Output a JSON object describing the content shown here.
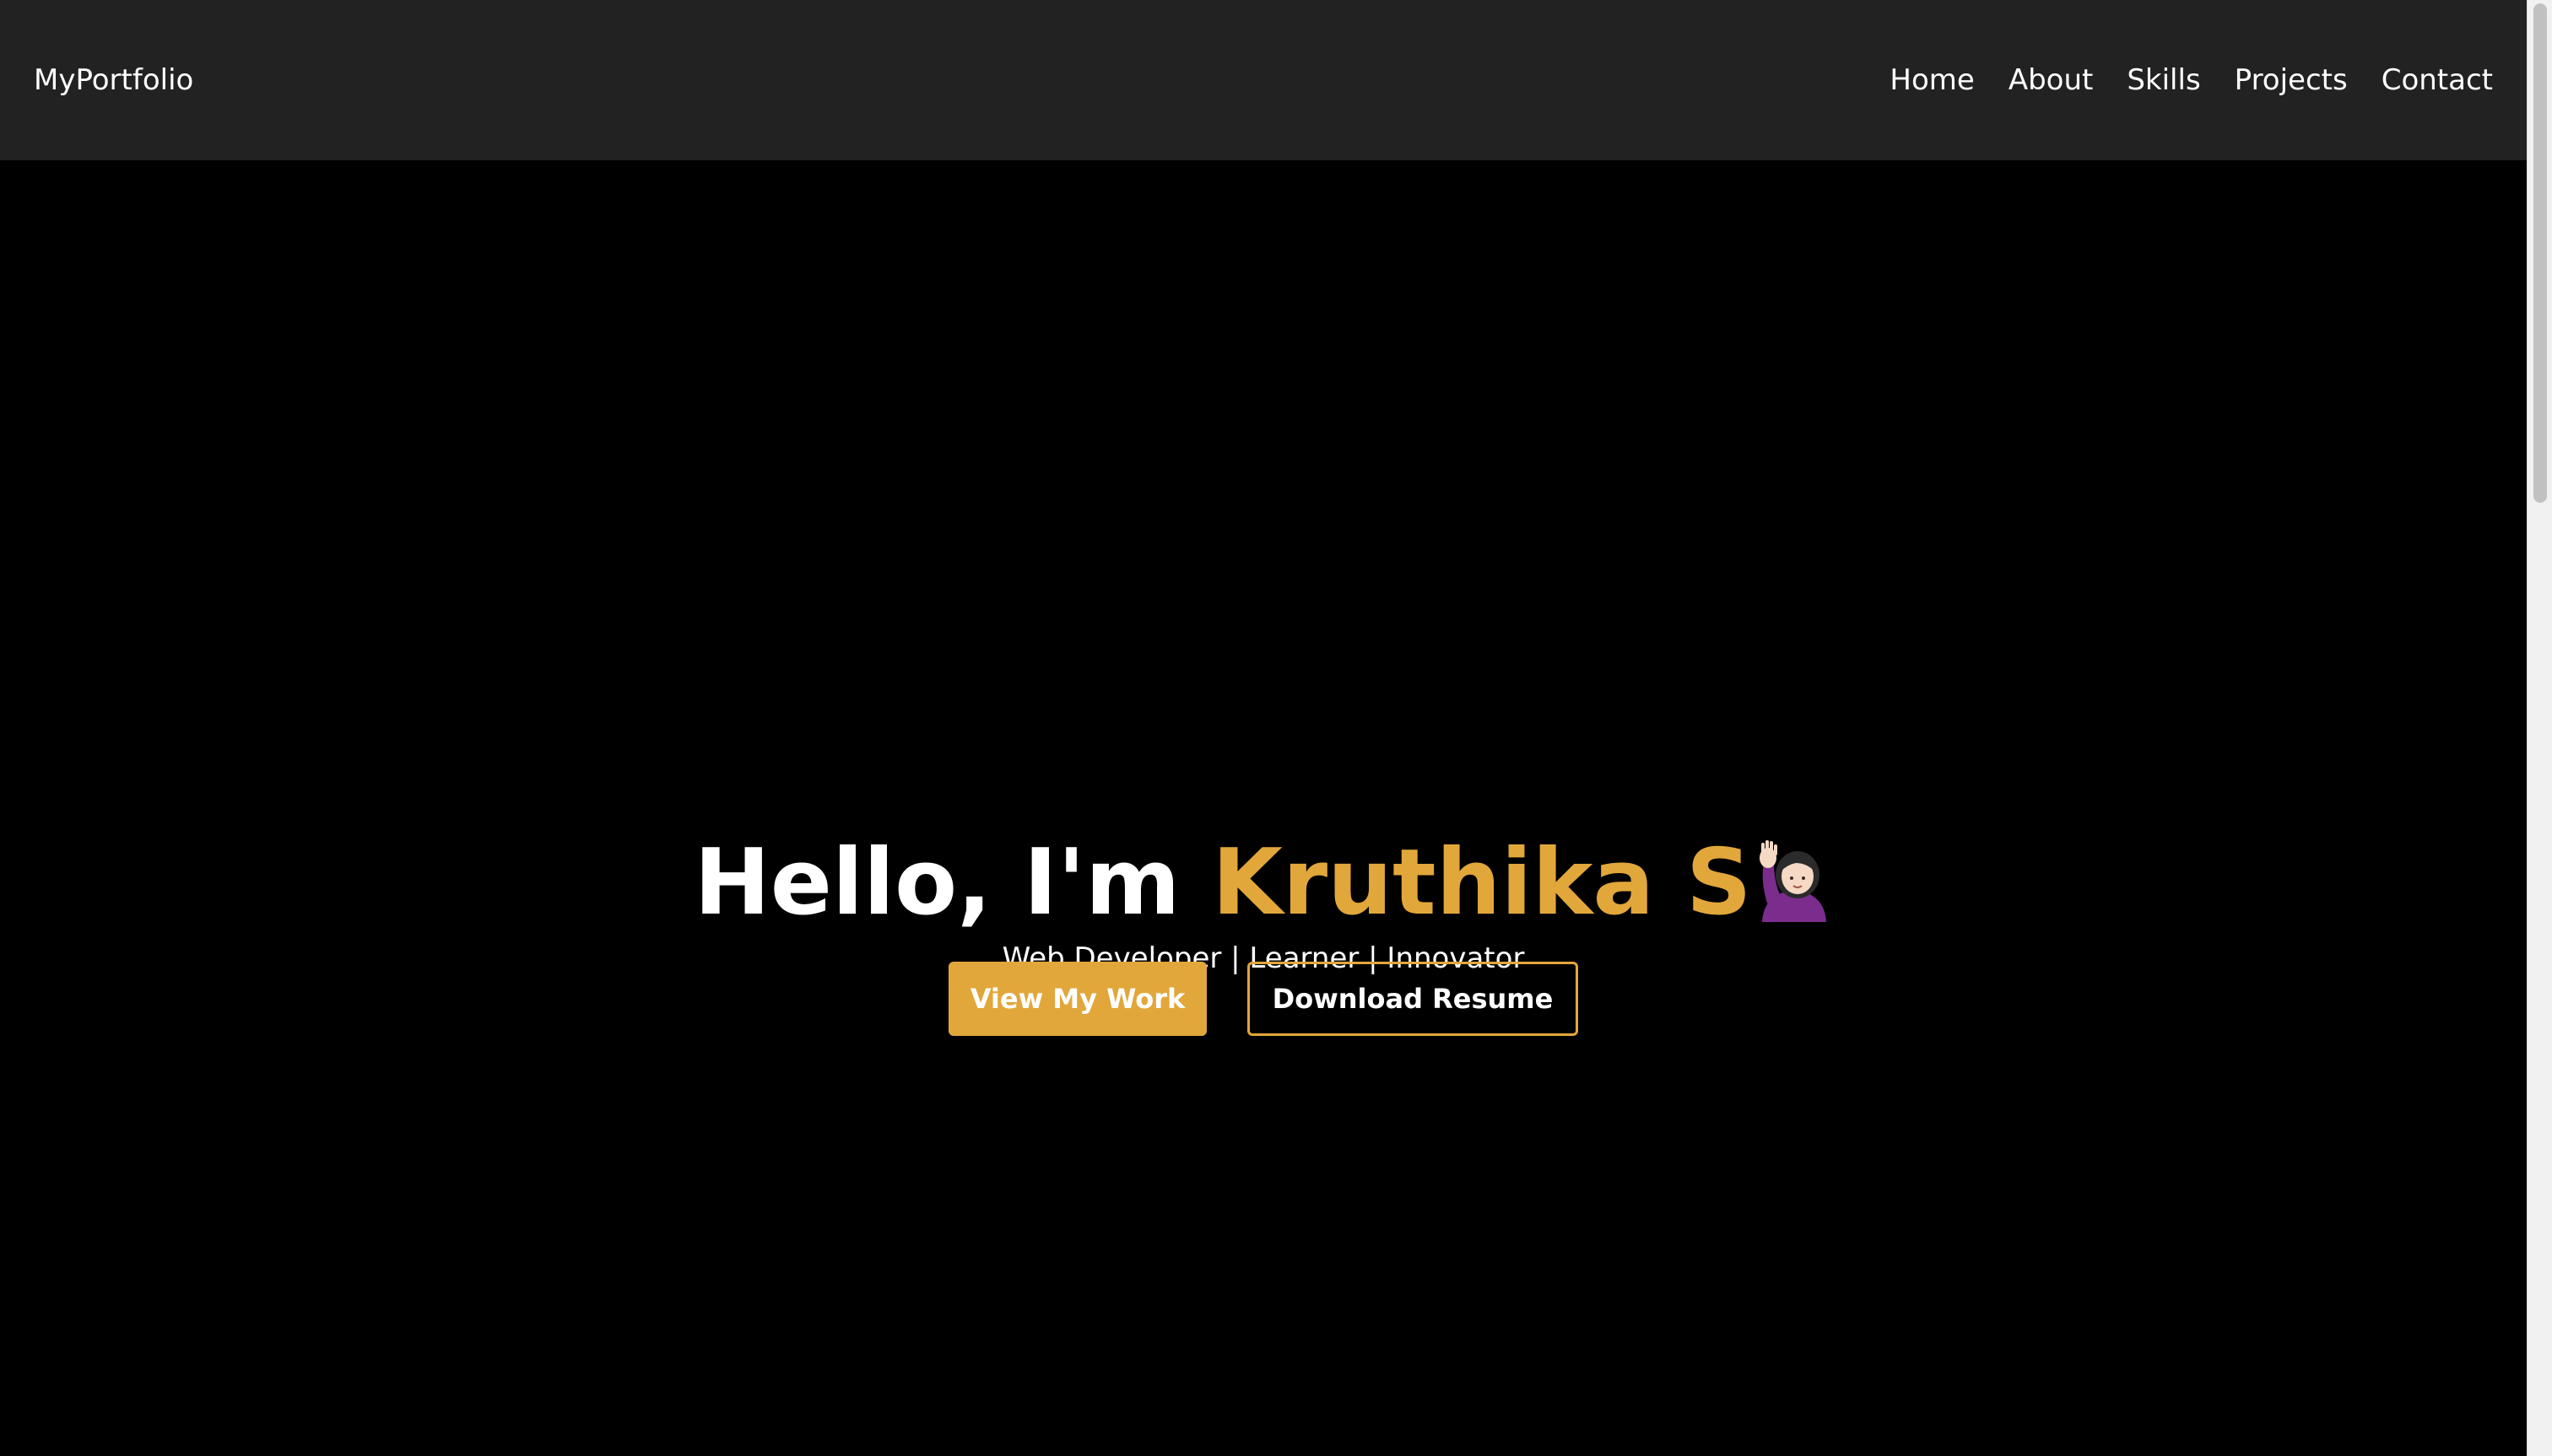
{
  "navbar": {
    "brand": "MyPortfolio",
    "links": [
      {
        "label": "Home"
      },
      {
        "label": "About"
      },
      {
        "label": "Skills"
      },
      {
        "label": "Projects"
      },
      {
        "label": "Contact"
      }
    ]
  },
  "hero": {
    "greeting": "Hello, I'm",
    "name": "Kruthika S",
    "emoji_icon": "person-raising-hand-icon",
    "subtitle": "Web Developer | Learner | Innovator",
    "primary_button": "View My Work",
    "secondary_button": "Download Resume"
  },
  "colors": {
    "accent": "#e2a73b",
    "navbar_bg": "#222222",
    "page_bg": "#000000",
    "text": "#ffffff"
  }
}
